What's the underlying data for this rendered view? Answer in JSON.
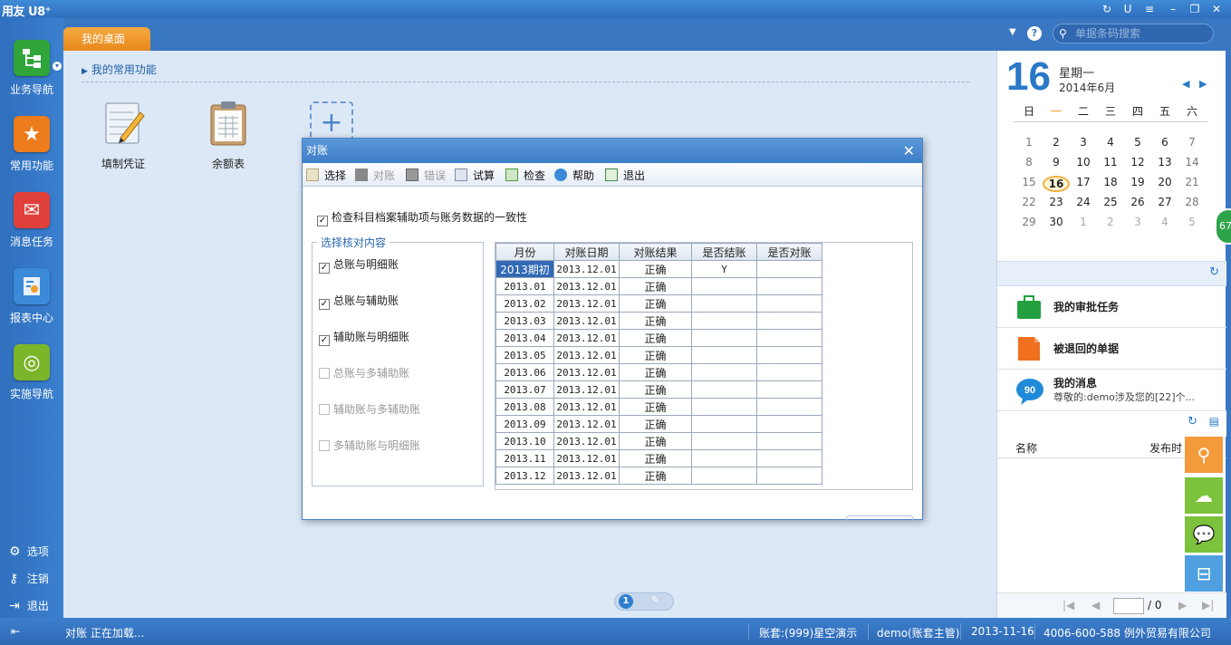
{
  "app": {
    "logo": "用友 U8⁺"
  },
  "sidebar": {
    "items": [
      {
        "label": "业务导航",
        "icon": "tree-icon",
        "color": "#2fa53a"
      },
      {
        "label": "常用功能",
        "icon": "star-icon",
        "color": "#ec7c1c"
      },
      {
        "label": "消息任务",
        "icon": "mail-icon",
        "color": "#e0403a"
      },
      {
        "label": "报表中心",
        "icon": "report-icon",
        "color": "#3a8ad8"
      },
      {
        "label": "实施导航",
        "icon": "compass-icon",
        "color": "#7ab52a"
      }
    ],
    "bottom": [
      {
        "label": "选项",
        "icon": "gear-icon"
      },
      {
        "label": "注销",
        "icon": "key-icon"
      },
      {
        "label": "退出",
        "icon": "exit-icon"
      }
    ]
  },
  "main": {
    "tab": "我的桌面",
    "favorites_heading": "我的常用功能",
    "favorites": [
      {
        "label": "填制凭证",
        "icon": "voucher-icon"
      },
      {
        "label": "余额表",
        "icon": "clipboard-icon"
      }
    ],
    "add_icon": "plus-icon",
    "page": "1"
  },
  "header": {
    "search_placeholder": "单据条码搜索"
  },
  "calendar": {
    "day": "16",
    "weekday": "星期一",
    "year_month": "2014年6月",
    "weekdays": [
      "日",
      "一",
      "二",
      "三",
      "四",
      "五",
      "六"
    ],
    "weeks": [
      [
        "1",
        "2",
        "3",
        "4",
        "5",
        "6",
        "7"
      ],
      [
        "8",
        "9",
        "10",
        "11",
        "12",
        "13",
        "14"
      ],
      [
        "15",
        "16",
        "17",
        "18",
        "19",
        "20",
        "21"
      ],
      [
        "22",
        "23",
        "24",
        "25",
        "26",
        "27",
        "28"
      ],
      [
        "29",
        "30",
        "1",
        "2",
        "3",
        "4",
        "5"
      ]
    ]
  },
  "tasks": [
    {
      "label": "我的审批任务",
      "icon": "briefcase-icon"
    },
    {
      "label": "被退回的单据",
      "icon": "document-icon"
    },
    {
      "label": "我的消息",
      "icon": "message-icon",
      "badge": "90",
      "subtitle": "尊敬的:demo涉及您的[22]个..."
    }
  ],
  "list": {
    "col_name": "名称",
    "col_time": "发布时"
  },
  "pager_right": {
    "total": "/ 0"
  },
  "badge_side": "67",
  "dialog": {
    "title": "对账",
    "toolbar": [
      {
        "label": "选择",
        "enabled": true,
        "icon": "select-icon"
      },
      {
        "label": "对账",
        "enabled": false,
        "icon": "reconcile-icon"
      },
      {
        "label": "错误",
        "enabled": false,
        "icon": "error-icon"
      },
      {
        "label": "试算",
        "enabled": true,
        "icon": "trial-icon"
      },
      {
        "label": "检查",
        "enabled": true,
        "icon": "check-icon"
      },
      {
        "label": "帮助",
        "enabled": true,
        "icon": "help-icon"
      },
      {
        "label": "退出",
        "enabled": true,
        "icon": "exit-icon"
      }
    ],
    "consistency_check": "检查科目档案辅助项与账务数据的一致性",
    "group_title": "选择核对内容",
    "options": [
      {
        "label": "总账与明细账",
        "checked": true,
        "enabled": true
      },
      {
        "label": "总账与辅助账",
        "checked": true,
        "enabled": true
      },
      {
        "label": "辅助账与明细账",
        "checked": true,
        "enabled": true
      },
      {
        "label": "总账与多辅助账",
        "checked": false,
        "enabled": false
      },
      {
        "label": "辅助账与多辅助账",
        "checked": false,
        "enabled": false
      },
      {
        "label": "多辅助账与明细账",
        "checked": false,
        "enabled": false
      }
    ],
    "table": {
      "headers": [
        "月份",
        "对账日期",
        "对账结果",
        "是否结账",
        "是否对账"
      ],
      "rows": [
        [
          "2013期初",
          "2013.12.01",
          "正确",
          "Y",
          ""
        ],
        [
          "2013.01",
          "2013.12.01",
          "正确",
          "",
          ""
        ],
        [
          "2013.02",
          "2013.12.01",
          "正确",
          "",
          ""
        ],
        [
          "2013.03",
          "2013.12.01",
          "正确",
          "",
          ""
        ],
        [
          "2013.04",
          "2013.12.01",
          "正确",
          "",
          ""
        ],
        [
          "2013.05",
          "2013.12.01",
          "正确",
          "",
          ""
        ],
        [
          "2013.06",
          "2013.12.01",
          "正确",
          "",
          ""
        ],
        [
          "2013.07",
          "2013.12.01",
          "正确",
          "",
          ""
        ],
        [
          "2013.08",
          "2013.12.01",
          "正确",
          "",
          ""
        ],
        [
          "2013.09",
          "2013.12.01",
          "正确",
          "",
          ""
        ],
        [
          "2013.10",
          "2013.12.01",
          "正确",
          "",
          ""
        ],
        [
          "2013.11",
          "2013.12.01",
          "正确",
          "",
          ""
        ],
        [
          "2013.12",
          "2013.12.01",
          "正确",
          "",
          ""
        ]
      ]
    }
  },
  "status": {
    "left": "对账  正在加载...",
    "account": "账套:(999)星空演示",
    "user": "demo(账套主管)",
    "date": "2013-11-16",
    "company": "4006-600-588 例外贸易有限公司"
  }
}
